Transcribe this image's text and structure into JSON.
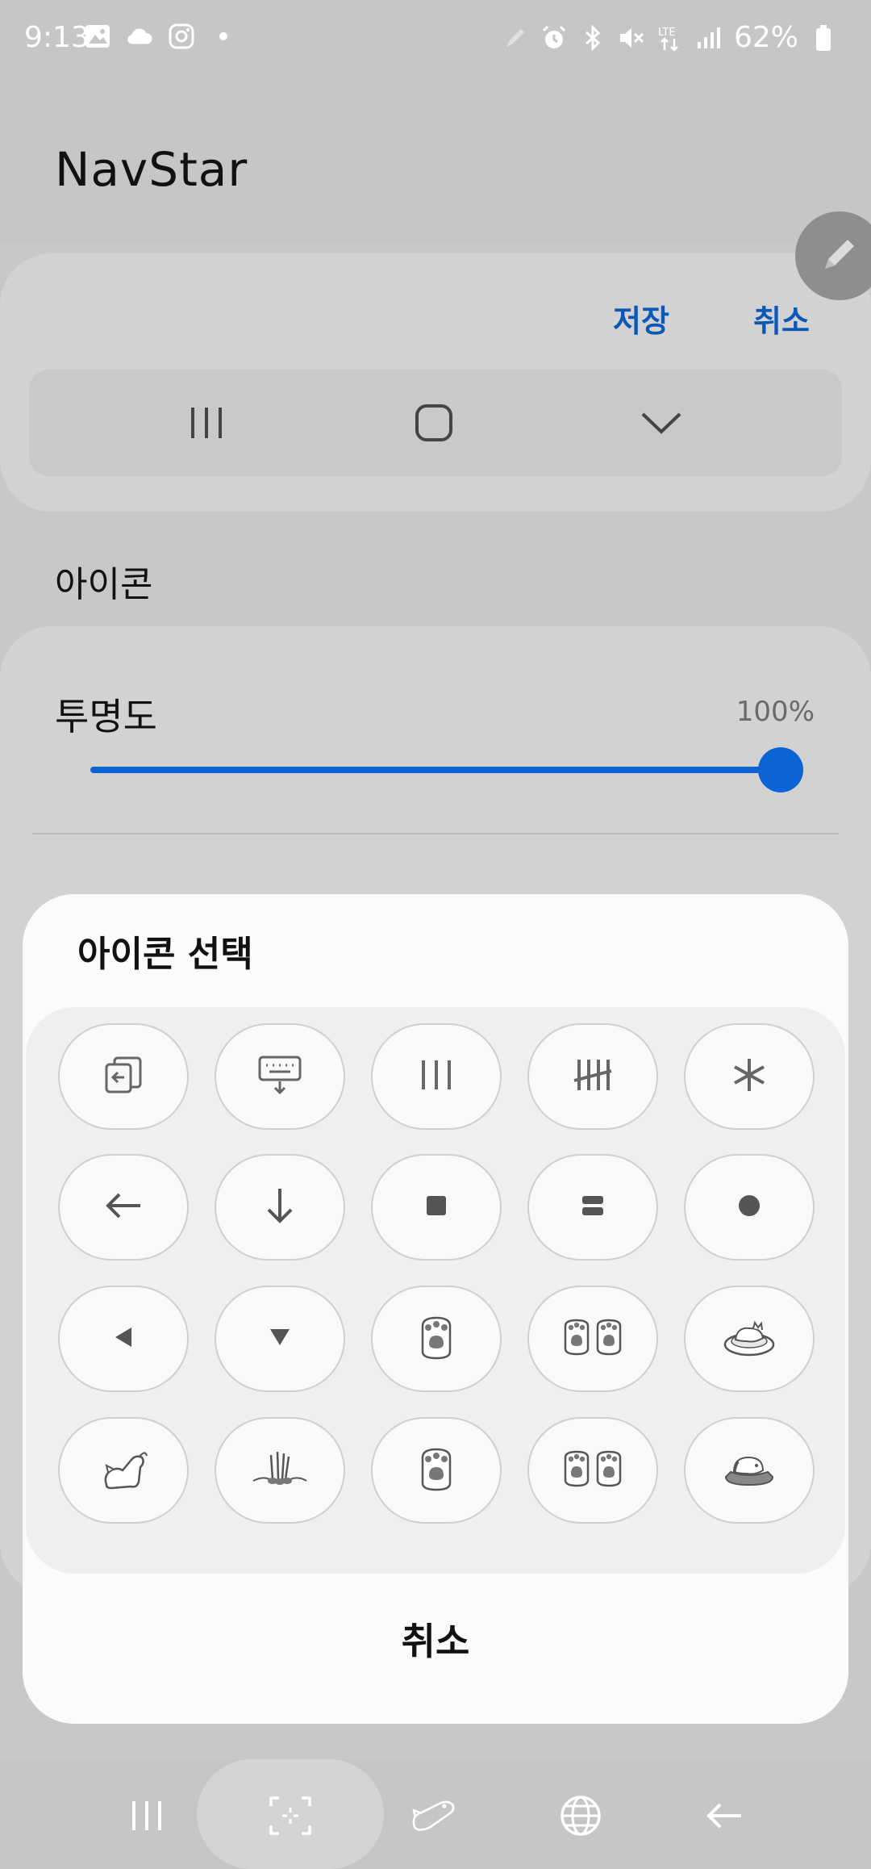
{
  "status_bar": {
    "time": "9:13",
    "battery": "62%",
    "network": "LTE"
  },
  "app": {
    "title": "NavStar"
  },
  "preview": {
    "save_label": "저장",
    "cancel_label": "취소",
    "buttons": [
      "recents-icon",
      "home-icon",
      "hide-chevron-icon"
    ]
  },
  "icon_section": {
    "label": "아이콘"
  },
  "opacity": {
    "label": "투명도",
    "value_text": "100%",
    "value": 1.0
  },
  "dialog": {
    "title": "아이콘 선택",
    "cancel_label": "취소",
    "icons": [
      "switch-window-icon",
      "keyboard-down-icon",
      "three-lines-icon",
      "hash-lines-icon",
      "asterisk-icon",
      "arrow-left-icon",
      "arrow-down-icon",
      "square-icon",
      "double-bar-icon",
      "circle-icon",
      "triangle-left-icon",
      "triangle-down-icon",
      "paw-icon",
      "double-paw-icon",
      "sleeping-cat-icon",
      "stretching-cat-icon",
      "cat-paws-icon",
      "paw-icon",
      "double-paw-icon",
      "sleeping-dog-icon"
    ]
  },
  "nav_bar": {
    "buttons": [
      "recents-icon",
      "screen-capture-icon",
      "cat-icon",
      "globe-icon",
      "back-icon"
    ]
  }
}
